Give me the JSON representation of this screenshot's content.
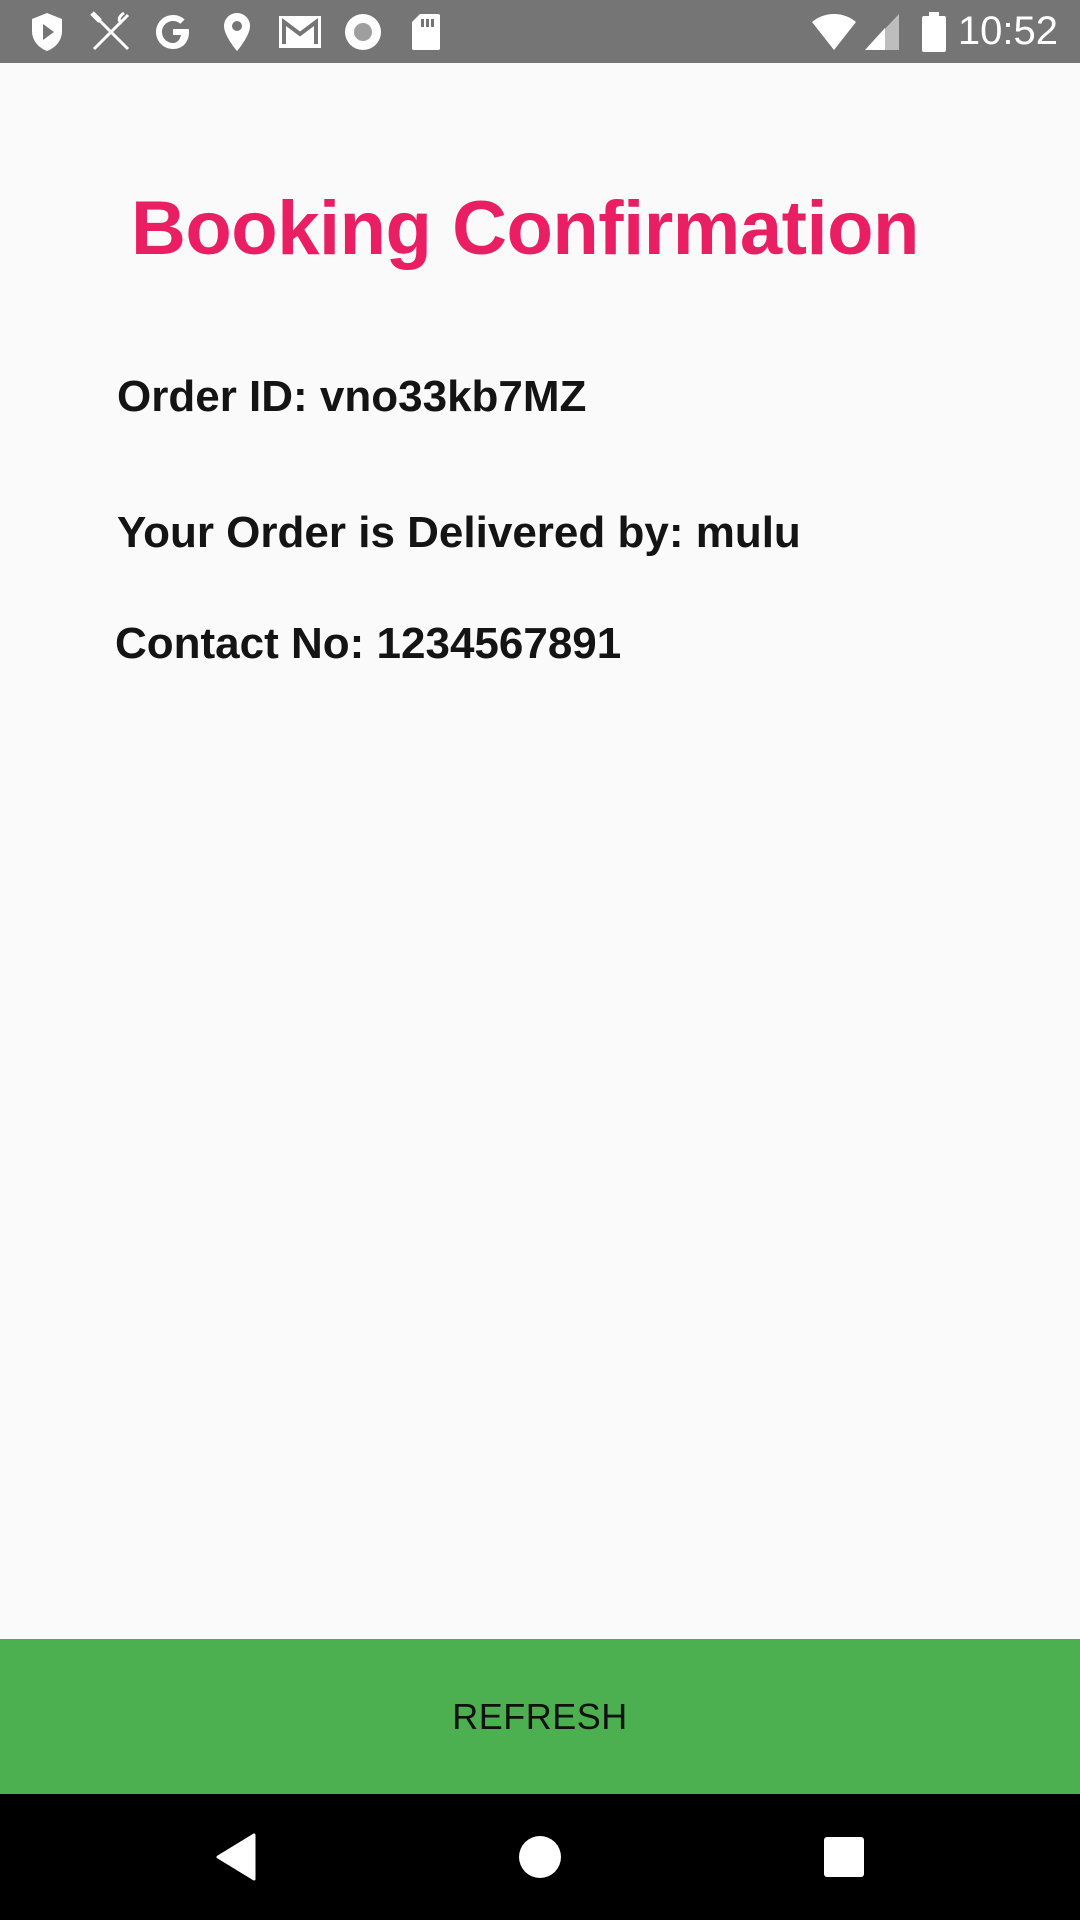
{
  "status_bar": {
    "time": "10:52",
    "left_icons": [
      "shield-play-icon",
      "restaurant-icon",
      "google-icon",
      "location-pin-icon",
      "gmail-icon",
      "record-icon",
      "sd-card-icon"
    ],
    "right_icons": [
      "wifi-icon",
      "cell-signal-icon",
      "battery-icon"
    ]
  },
  "main": {
    "title": "Booking Confirmation",
    "order_id": "Order ID: vno33kb7MZ",
    "delivered_by": "Your Order is Delivered by: mulu",
    "contact": "Contact No: 1234567891"
  },
  "refresh_label": "REFRESH",
  "nav_bar": {
    "buttons": [
      "back-icon",
      "home-icon",
      "recents-icon"
    ]
  },
  "colors": {
    "title": "#e91e63",
    "button": "#4caf50",
    "status_bar": "#757575",
    "background": "#fafafa"
  }
}
